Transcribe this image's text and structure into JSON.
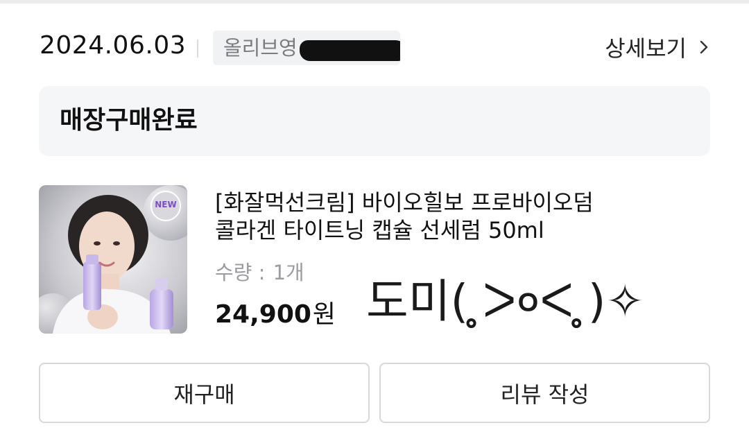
{
  "order": {
    "date": "2024.06.03",
    "store_label": "올리브영",
    "detail_label": "상세보기"
  },
  "status": {
    "text": "매장구매완료"
  },
  "product": {
    "name_line1": "[화잘먹선크림] 바이오힐보 프로바이오덤",
    "name_line2": "콜라겐 타이트닝 캡슐 선세럼 50ml",
    "qty_label": "수량 : ",
    "qty_value": "1개",
    "price": "24,900",
    "currency": "원",
    "badge": "NEW"
  },
  "overlay_text": "도미( ̥̥ᐳ०ᐸ ̥̥)✧",
  "actions": {
    "rebuy_label": "재구매",
    "review_label": "리뷰 작성"
  },
  "icons": {
    "detail_chevron": "chevron-right-icon"
  },
  "colors": {
    "card_bg": "#f5f6f8",
    "chip_bg": "#f1f2f4",
    "border": "#d8d8dc",
    "muted_text": "#9a9ca1"
  }
}
